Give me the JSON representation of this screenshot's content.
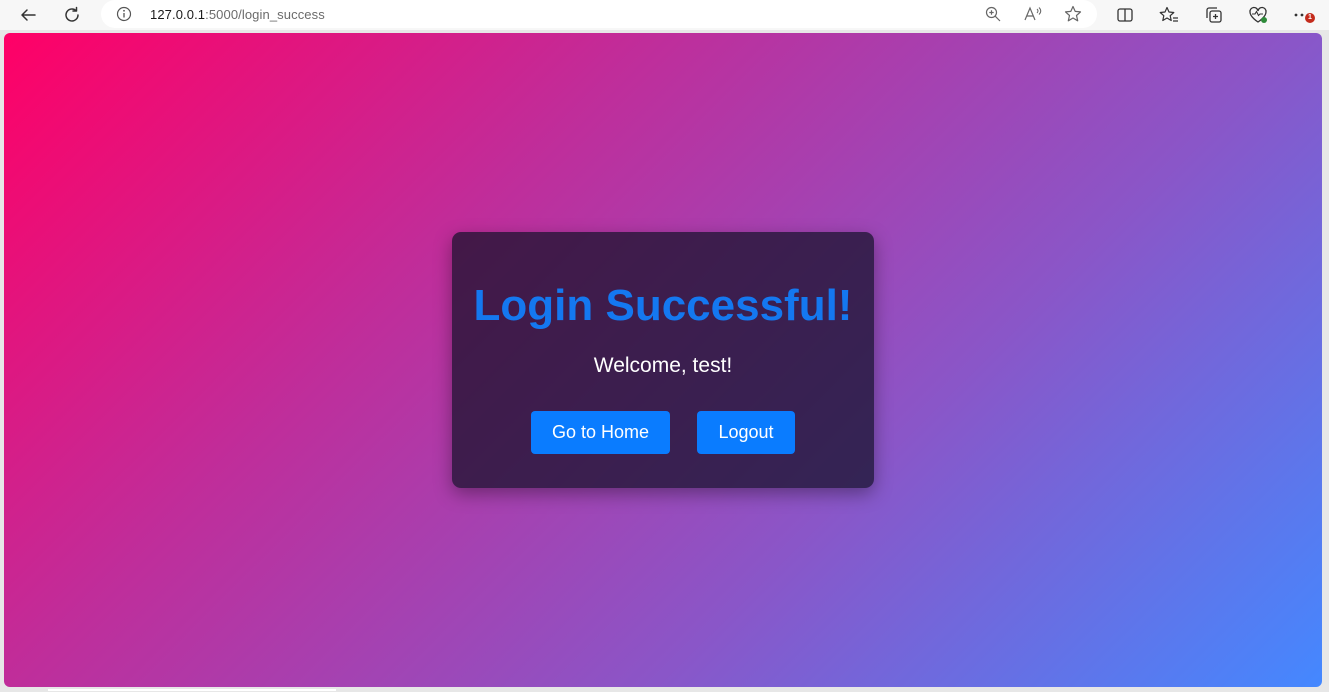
{
  "browser": {
    "url_host": "127.0.0.1",
    "url_path": ":5000/login_success",
    "notification_count": "1",
    "icons": {
      "back": "back-arrow-icon",
      "refresh": "refresh-icon",
      "info": "info-icon",
      "zoom": "zoom-icon",
      "read_aloud": "read-aloud-icon",
      "favorite": "star-icon",
      "split_screen": "split-screen-icon",
      "favorites": "favorites-icon",
      "collections": "collections-icon",
      "browser_essentials": "heart-pulse-icon",
      "more": "more-icon"
    }
  },
  "page": {
    "title": "Login Successful!",
    "welcome": "Welcome, test!",
    "home_button": "Go to Home",
    "logout_button": "Logout"
  },
  "colors": {
    "gradient_start": "#ff0066",
    "gradient_end": "#4488ff",
    "title": "#1478f0",
    "button": "#0a7cff",
    "card_bg": "rgba(20,16,40,0.72)"
  }
}
